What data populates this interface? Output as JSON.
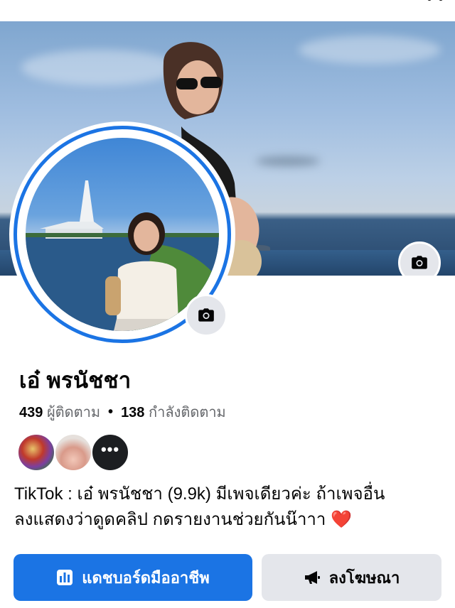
{
  "profile": {
    "name": "เอ๋ พรนัชชา",
    "followers_count": "439",
    "followers_label": "ผู้ติดตาม",
    "separator": "•",
    "following_count": "138",
    "following_label": "กำลังติดตาม"
  },
  "friends_preview": {
    "more_label": "•••"
  },
  "bio": {
    "line1": "TikTok : เอ๋ พรนัชชา (9.9k) มีเพจเดียวค่ะ ถ้าเพจอื่น",
    "line2": "ลงแสดงว่าดูดคลิป กดรายงานช่วยกันน๊าาา",
    "emoji": "❤️"
  },
  "actions": {
    "dashboard_label": "แดชบอร์ดมืออาชีพ",
    "advertise_label": "ลงโฆษณา"
  },
  "icons": {
    "cover_camera": "camera-icon",
    "profile_camera": "camera-icon",
    "dashboard": "bar-chart-icon",
    "advertise": "megaphone-icon"
  },
  "colors": {
    "accent": "#1b74e4",
    "secondary_button": "#e4e6eb",
    "muted_text": "#65676b"
  }
}
